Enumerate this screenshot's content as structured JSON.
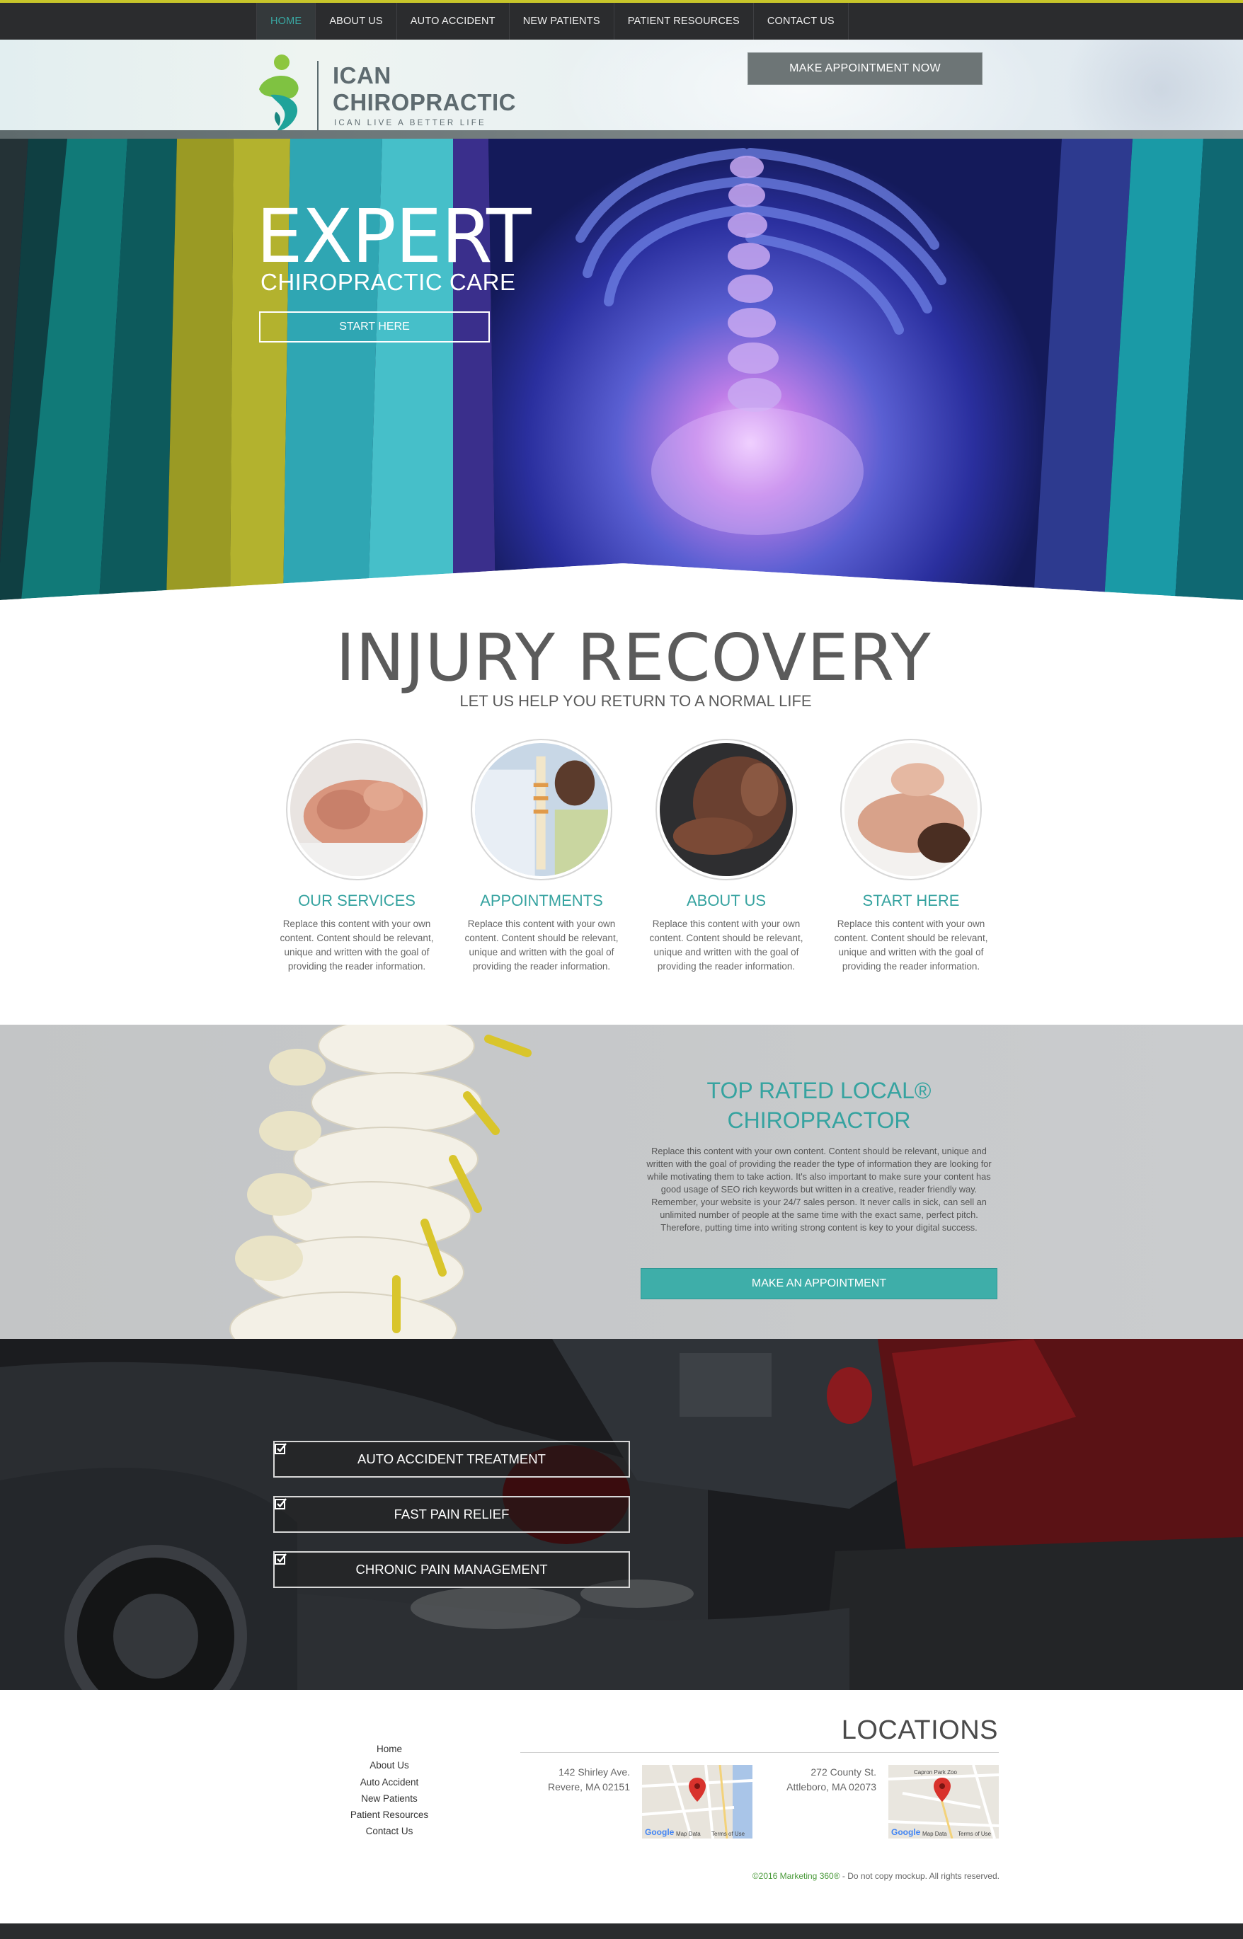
{
  "nav": {
    "items": [
      {
        "label": "Home",
        "active": true
      },
      {
        "label": "About Us"
      },
      {
        "label": "Auto Accident"
      },
      {
        "label": "New Patients"
      },
      {
        "label": "Patient Resources"
      },
      {
        "label": "Contact Us"
      }
    ]
  },
  "header": {
    "logo_line1": "ICAN",
    "logo_line2": "CHIROPRACTIC",
    "logo_tagline": "ICAN LIVE A BETTER LIFE",
    "appointment_button": "Make Appointment Now"
  },
  "hero": {
    "title": "EXPERT",
    "subtitle": "Chiropractic Care",
    "button": "Start Here"
  },
  "recovery": {
    "title": "INJURY RECOVERY",
    "subtitle": "Let us help you return to a normal life",
    "features": [
      {
        "title": "Our Services",
        "text": "Replace this content with your own content. Content should be relevant, unique and written with the goal of providing the reader information."
      },
      {
        "title": "Appointments",
        "text": "Replace this content with your own content. Content should be relevant, unique and written with the goal of providing the reader information."
      },
      {
        "title": "About Us",
        "text": "Replace this content with your own content. Content should be relevant, unique and written with the goal of providing the reader information."
      },
      {
        "title": "Start Here",
        "text": "Replace this content with your own content. Content should be relevant, unique and written with the goal of providing the reader information."
      }
    ]
  },
  "toprated": {
    "title_line1": "Top Rated Local®",
    "title_line2": "Chiropractor",
    "body": "Replace this content with your own content. Content should be relevant, unique and written with the goal of providing the reader the type of information they are looking for while motivating them to take action. It's also important to make sure your content has good usage of SEO rich keywords but written in a creative, reader friendly way. Remember, your website is your 24/7 sales person. It never calls in sick, can sell an unlimited number of people at the same time with the exact same, perfect pitch. Therefore, putting time into writing strong content is key to your digital success.",
    "button": "Make An Appointment"
  },
  "treatments": [
    {
      "label": "Auto Accident Treatment",
      "icon": "checkbox-icon"
    },
    {
      "label": "Fast Pain Relief",
      "icon": "checkbox-icon"
    },
    {
      "label": "Chronic Pain Management",
      "icon": "checkbox-icon"
    }
  ],
  "footer": {
    "links": [
      "Home",
      "About Us",
      "Auto Accident",
      "New Patients",
      "Patient Resources",
      "Contact Us"
    ],
    "locations_title": "LOCATIONS",
    "locations": [
      {
        "street": "142 Shirley Ave.",
        "city": "Revere, MA 02151",
        "map_google": "Google",
        "map_data": "Map Data",
        "map_terms": "Terms of Use"
      },
      {
        "street": "272 County St.",
        "city": "Attleboro, MA 02073",
        "map_google": "Google",
        "map_data": "Map Data",
        "map_terms": "Terms of Use",
        "map_label": "Capron Park Zoo"
      }
    ],
    "copyright_brand": "©2016 Marketing 360®",
    "copyright_rest": " - Do not copy mockup. All rights reserved."
  },
  "colors": {
    "accent": "#36a3a0",
    "nav_bg": "#2b2c2e",
    "nav_top_border": "#c7c52a",
    "button_gray": "#6d7576",
    "button_teal": "#3eaea9"
  }
}
